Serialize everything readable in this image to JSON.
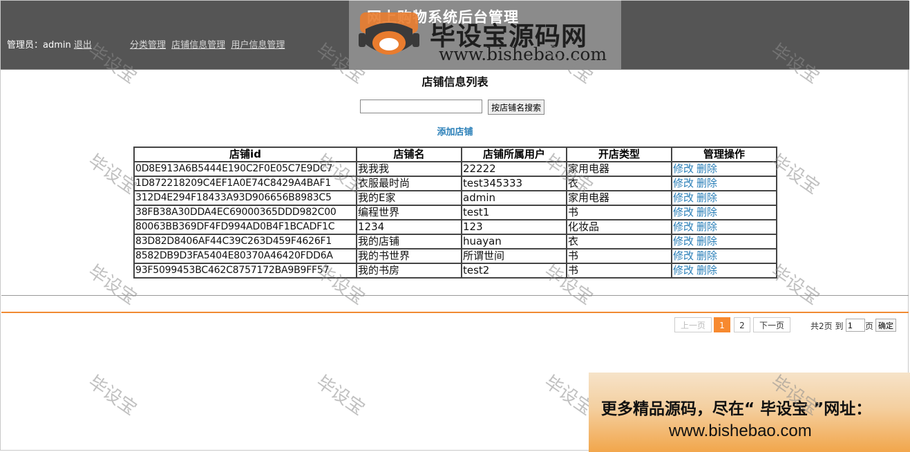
{
  "header": {
    "system_title": "网上购物系统后台管理",
    "admin_label": "管理员：admin",
    "logout": "退出",
    "nav": [
      "分类管理",
      "店铺信息管理",
      "用户信息管理"
    ]
  },
  "watermark": {
    "logo_text": "毕设宝源码网",
    "logo_url": "www.bishebao.com",
    "diagonal_text": "毕设宝"
  },
  "page_title": "店铺信息列表",
  "search": {
    "value": "",
    "button": "按店铺名搜索"
  },
  "add_link": "添加店铺",
  "table": {
    "headers": [
      "店铺id",
      "店铺名",
      "店铺所属用户",
      "开店类型",
      "管理操作"
    ],
    "edit_label": "修改",
    "delete_label": "删除",
    "rows": [
      [
        "0D8E913A6B5444E190C2F0E05C7E9DC7",
        "我我我",
        "22222",
        "家用电器"
      ],
      [
        "1D872218209C4EF1A0E74C8429A4BAF1",
        "衣服最时尚",
        "test345333",
        "衣"
      ],
      [
        "312D4E294F18433A93D906656B8983C5",
        "我的E家",
        "admin",
        "家用电器"
      ],
      [
        "38FB38A30DDA4EC69000365DDD982C00",
        "编程世界",
        "test1",
        "书"
      ],
      [
        "80063BB369DF4FD994AD0B4F1BCADF1C",
        "1234",
        "123",
        "化妆品"
      ],
      [
        "83D82D8406AF44C39C263D459F4626F1",
        "我的店铺",
        "huayan",
        "衣"
      ],
      [
        "8582DB9D3FA5404E80370A46420FDD6A",
        "我的书世界",
        "所谓世间",
        "书"
      ],
      [
        "93F5099453BC462C8757172BA9B9FF57",
        "我的书房",
        "test2",
        "书"
      ]
    ]
  },
  "pager": {
    "prev": "上一页",
    "pages": [
      "1",
      "2"
    ],
    "current": "1",
    "next": "下一页",
    "total_text": "共2页 到",
    "goto_value": "1",
    "unit": "页",
    "confirm": "确定"
  },
  "promo": {
    "line1": "更多精品源码，尽在“ 毕设宝 ”网址：",
    "line2": "www.bishebao.com"
  },
  "colors": {
    "header_bg": "#555555",
    "link": "#2a7fb8",
    "accent": "#f7892f"
  }
}
